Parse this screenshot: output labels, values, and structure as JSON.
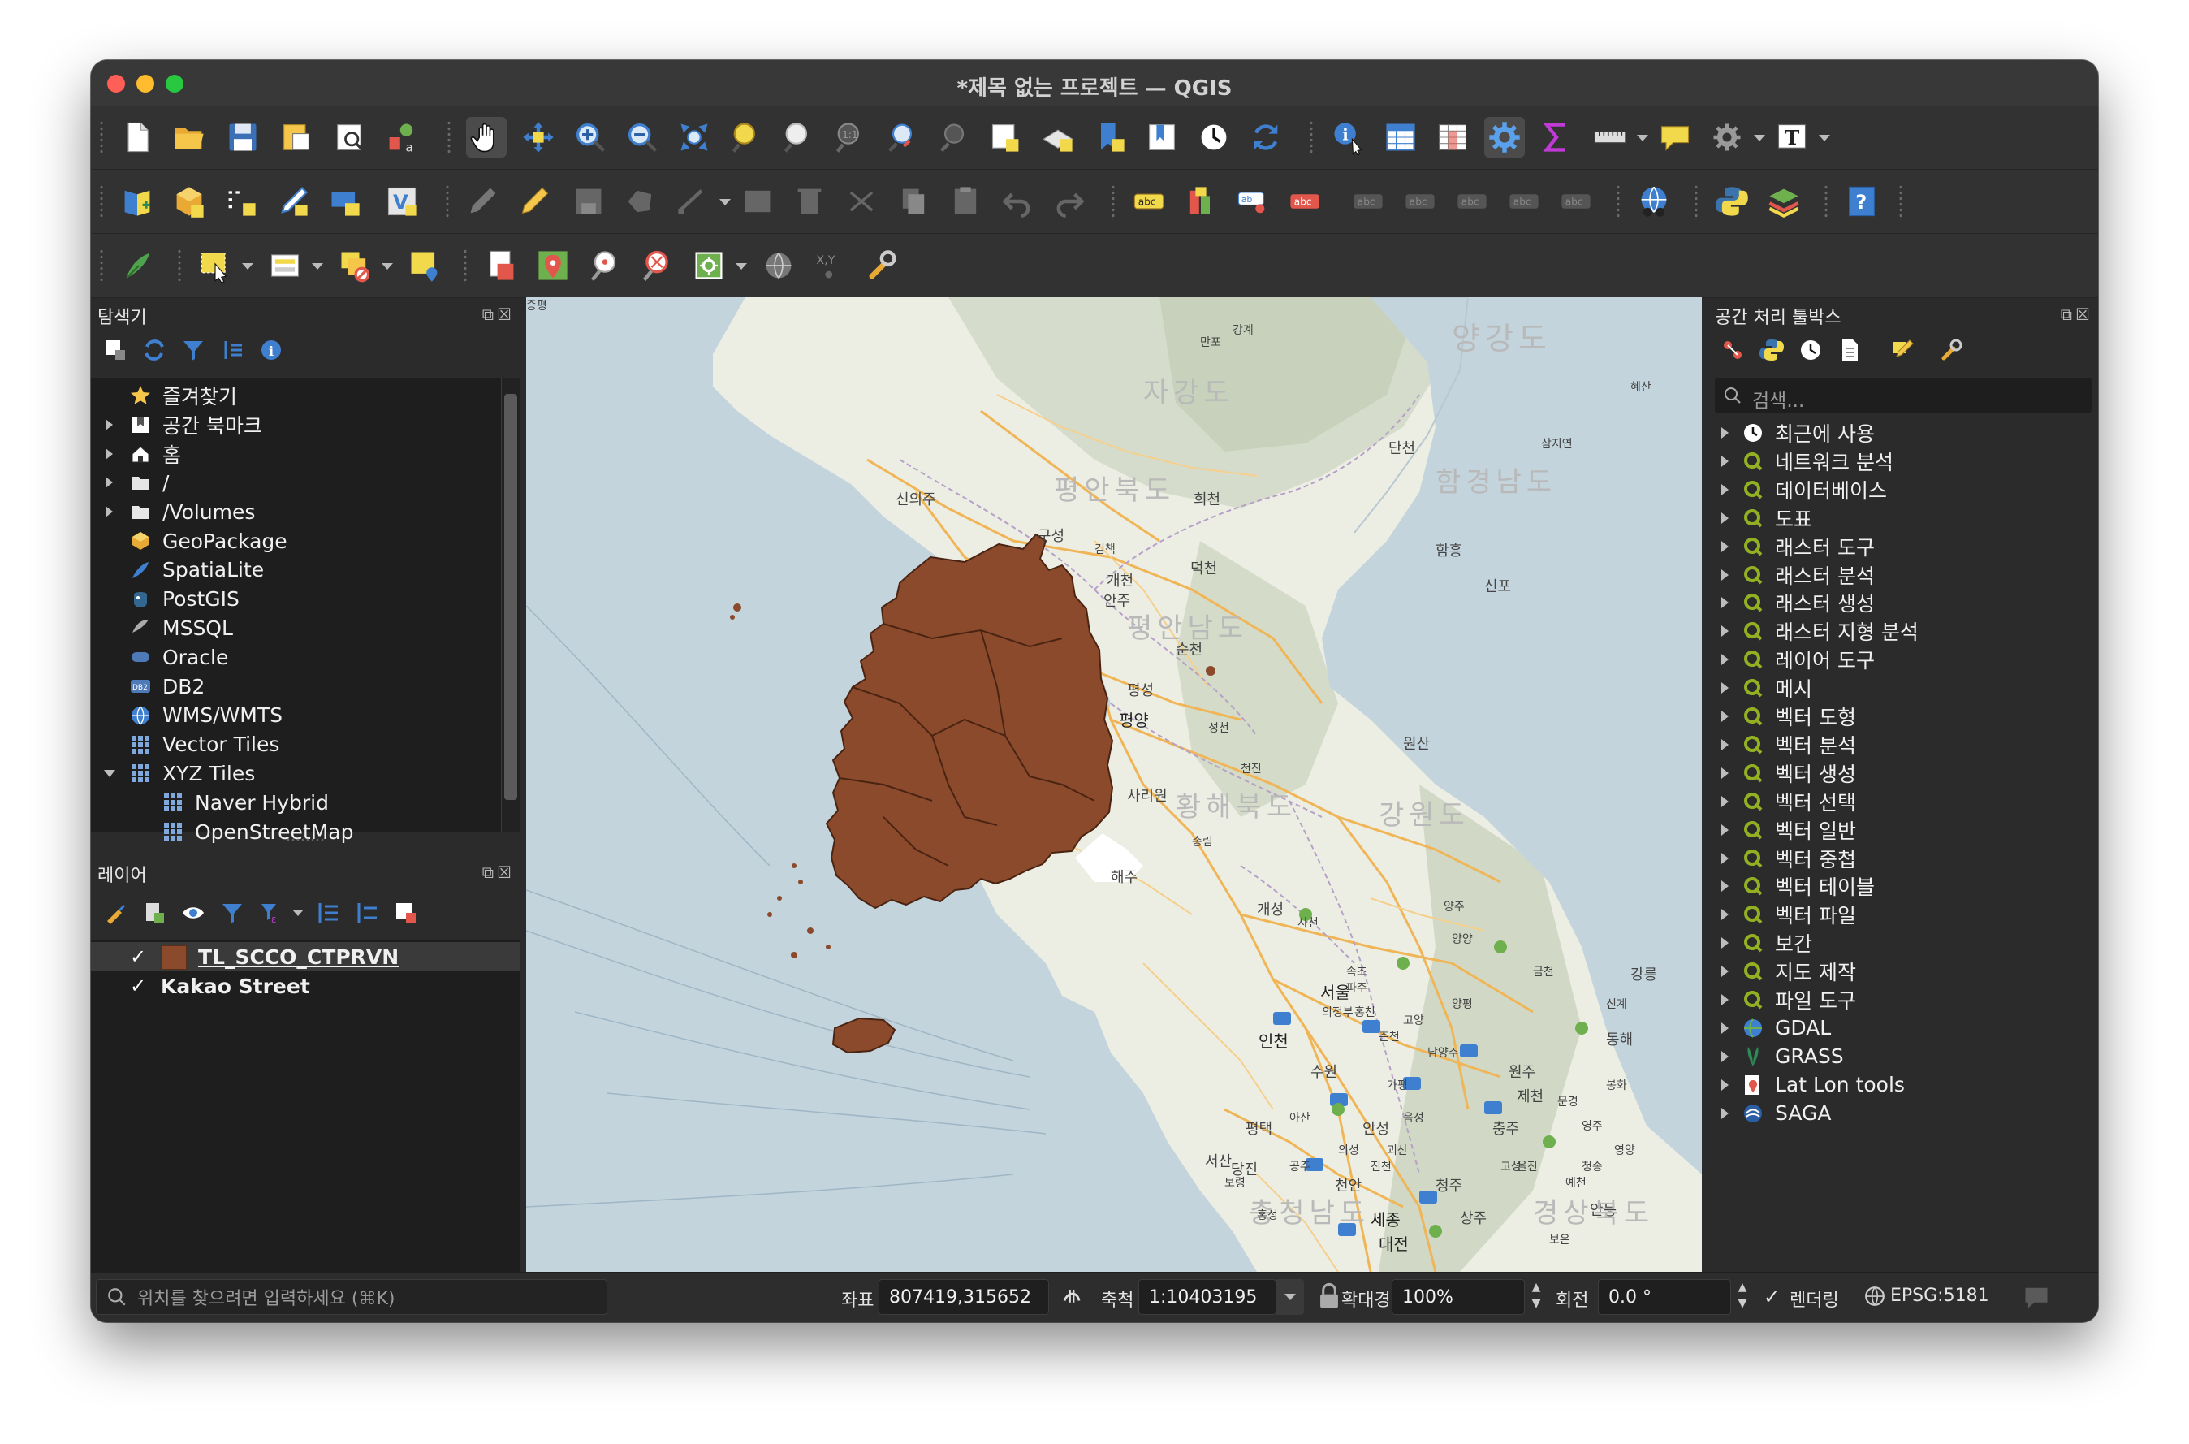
{
  "window": {
    "title": "*제목 없는 프로젝트 — QGIS"
  },
  "colors": {
    "accent": "#8B4A2B",
    "qgis_green": "#63a12e",
    "map_water": "#c9d8df",
    "map_land": "#eceee4"
  },
  "browser": {
    "title": "탐색기",
    "items": [
      {
        "label": "즐겨찾기",
        "icon": "star-icon",
        "expander": "none"
      },
      {
        "label": "공간 북마크",
        "icon": "bookmark-icon",
        "expander": "right"
      },
      {
        "label": "홈",
        "icon": "home-icon",
        "expander": "right"
      },
      {
        "label": "/",
        "icon": "folder-icon",
        "expander": "right"
      },
      {
        "label": "/Volumes",
        "icon": "folder-icon",
        "expander": "right"
      },
      {
        "label": "GeoPackage",
        "icon": "geopackage-icon",
        "expander": "none"
      },
      {
        "label": "SpatiaLite",
        "icon": "spatialite-icon",
        "expander": "none"
      },
      {
        "label": "PostGIS",
        "icon": "postgis-icon",
        "expander": "none"
      },
      {
        "label": "MSSQL",
        "icon": "mssql-icon",
        "expander": "none"
      },
      {
        "label": "Oracle",
        "icon": "oracle-icon",
        "expander": "none"
      },
      {
        "label": "DB2",
        "icon": "db2-icon",
        "expander": "none"
      },
      {
        "label": "WMS/WMTS",
        "icon": "globe-icon",
        "expander": "none"
      },
      {
        "label": "Vector Tiles",
        "icon": "grid-icon",
        "expander": "none"
      },
      {
        "label": "XYZ Tiles",
        "icon": "grid-icon",
        "expander": "down"
      },
      {
        "label": "Naver Hybrid",
        "icon": "grid-icon",
        "expander": "child"
      },
      {
        "label": "OpenStreetMap",
        "icon": "grid-icon",
        "expander": "child"
      }
    ]
  },
  "layers": {
    "title": "레이어",
    "items": [
      {
        "label": "TL_SCCO_CTPRVN",
        "checked": true,
        "swatch": "#8B4A2B"
      },
      {
        "label": "Kakao Street",
        "checked": true
      }
    ]
  },
  "processing": {
    "title": "공간 처리 툴박스",
    "search_placeholder": "검색...",
    "items": [
      {
        "label": "최근에 사용",
        "icon": "clock-icon"
      },
      {
        "label": "네트워크 분석",
        "icon": "qgis-icon"
      },
      {
        "label": "데이터베이스",
        "icon": "qgis-icon"
      },
      {
        "label": "도표",
        "icon": "qgis-icon"
      },
      {
        "label": "래스터 도구",
        "icon": "qgis-icon"
      },
      {
        "label": "래스터 분석",
        "icon": "qgis-icon"
      },
      {
        "label": "래스터 생성",
        "icon": "qgis-icon"
      },
      {
        "label": "래스터 지형 분석",
        "icon": "qgis-icon"
      },
      {
        "label": "레이어 도구",
        "icon": "qgis-icon"
      },
      {
        "label": "메시",
        "icon": "qgis-icon"
      },
      {
        "label": "벡터 도형",
        "icon": "qgis-icon"
      },
      {
        "label": "벡터 분석",
        "icon": "qgis-icon"
      },
      {
        "label": "벡터 생성",
        "icon": "qgis-icon"
      },
      {
        "label": "벡터 선택",
        "icon": "qgis-icon"
      },
      {
        "label": "벡터 일반",
        "icon": "qgis-icon"
      },
      {
        "label": "벡터 중첩",
        "icon": "qgis-icon"
      },
      {
        "label": "벡터 테이블",
        "icon": "qgis-icon"
      },
      {
        "label": "벡터 파일",
        "icon": "qgis-icon"
      },
      {
        "label": "보간",
        "icon": "qgis-icon"
      },
      {
        "label": "지도 제작",
        "icon": "qgis-icon"
      },
      {
        "label": "파일 도구",
        "icon": "qgis-icon"
      },
      {
        "label": "GDAL",
        "icon": "gdal-icon"
      },
      {
        "label": "GRASS",
        "icon": "grass-icon"
      },
      {
        "label": "Lat Lon tools",
        "icon": "latlon-icon"
      },
      {
        "label": "SAGA",
        "icon": "saga-icon"
      }
    ]
  },
  "map_labels": [
    "양강도",
    "자강도",
    "평안북도",
    "함경남도",
    "신의주",
    "구성",
    "희천",
    "단천",
    "신포",
    "함흥",
    "덕천",
    "개천",
    "안주",
    "평안남도",
    "순천",
    "평성",
    "평양",
    "원산",
    "황해북도",
    "강원도",
    "사리원",
    "해주",
    "개성",
    "서울",
    "인천",
    "강릉",
    "동해",
    "충주",
    "원주",
    "수원",
    "평택",
    "안성",
    "제천",
    "서산",
    "천안",
    "당진",
    "세종",
    "대전",
    "청주",
    "충청남도",
    "상주",
    "안동",
    "경상북도",
    "강계",
    "만포",
    "혜산",
    "삼지연",
    "김책",
    "성천",
    "천진",
    "송림",
    "사천",
    "신계",
    "금천",
    "양양",
    "속초",
    "홍천",
    "춘천",
    "의정부",
    "파주",
    "고양",
    "남양주",
    "가평",
    "양평",
    "양주",
    "고성",
    "문경",
    "영주",
    "봉화",
    "울진",
    "예천",
    "의성",
    "보은",
    "청송",
    "영양",
    "공주",
    "보령",
    "홍성",
    "아산",
    "음성",
    "괴산",
    "진천",
    "증평"
  ],
  "status": {
    "locate_placeholder": "위치를 찾으려면 입력하세요 (⌘K)",
    "coord_label": "좌표",
    "coord_value": "807419,315652",
    "scale_label": "축척",
    "scale_value": "1:10403195",
    "magnifier_label": "확대경",
    "magnifier_value": "100%",
    "rotation_label": "회전",
    "rotation_value": "0.0 °",
    "render_label": "렌더링",
    "crs": "EPSG:5181"
  }
}
